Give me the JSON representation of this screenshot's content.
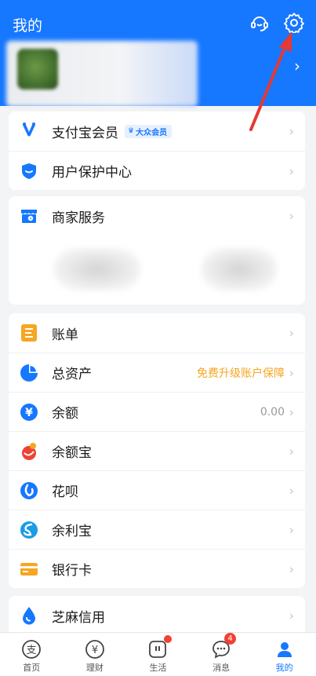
{
  "header": {
    "title": "我的"
  },
  "member_card": {
    "items": [
      {
        "label": "支付宝会员",
        "badge": "大众会员",
        "icon": "alipay-member-v-icon"
      },
      {
        "label": "用户保护中心",
        "icon": "shield-icon"
      }
    ]
  },
  "merchant_card": {
    "label": "商家服务",
    "icon": "store-icon"
  },
  "finance_card": {
    "items": [
      {
        "label": "账单",
        "icon": "bill-icon"
      },
      {
        "label": "总资产",
        "right_text": "免费升级账户保障",
        "icon": "pie-chart-icon"
      },
      {
        "label": "余额",
        "right_text": "0.00",
        "icon": "yuan-coin-icon"
      },
      {
        "label": "余额宝",
        "icon": "yuebao-icon"
      },
      {
        "label": "花呗",
        "icon": "huabei-icon"
      },
      {
        "label": "余利宝",
        "icon": "yulibao-icon"
      },
      {
        "label": "银行卡",
        "icon": "bank-card-icon"
      }
    ]
  },
  "credit_card": {
    "label": "芝麻信用",
    "icon": "sesame-drop-icon"
  },
  "tabbar": {
    "items": [
      {
        "label": "首页",
        "icon": "alipay-home-icon"
      },
      {
        "label": "理财",
        "icon": "finance-yuan-icon"
      },
      {
        "label": "生活",
        "icon": "life-icon"
      },
      {
        "label": "消息",
        "icon": "message-icon",
        "count": "4"
      },
      {
        "label": "我的",
        "icon": "me-icon"
      }
    ]
  },
  "colors": {
    "brand": "#1677ff",
    "orange": "#f5a623",
    "red": "#f04134"
  }
}
